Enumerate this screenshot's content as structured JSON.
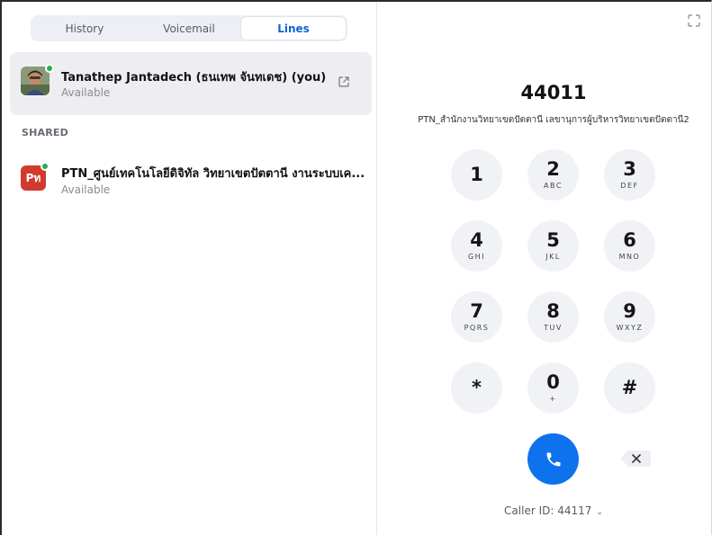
{
  "tabs": [
    {
      "label": "History"
    },
    {
      "label": "Voicemail"
    },
    {
      "label": "Lines"
    }
  ],
  "my_line": {
    "name": "Tanathep Jantadech (ธนเทพ จันทเดช) (you)",
    "status": "Available"
  },
  "shared": {
    "section_label": "SHARED",
    "line": {
      "avatar_text": "Pท",
      "name": "PTN_ศูนย์เทคโนโลยีดิจิทัล วิทยาเขตปัตตานี งานระบบเค...",
      "status": "Available"
    }
  },
  "dialer": {
    "number": "44011",
    "line_description": "PTN_สำนักงานวิทยาเขตปัตตานี เลขานุการผู้บริหารวิทยาเขตปัตตานี2",
    "keys": [
      {
        "digit": "1",
        "letters": ""
      },
      {
        "digit": "2",
        "letters": "ABC"
      },
      {
        "digit": "3",
        "letters": "DEF"
      },
      {
        "digit": "4",
        "letters": "GHI"
      },
      {
        "digit": "5",
        "letters": "JKL"
      },
      {
        "digit": "6",
        "letters": "MNO"
      },
      {
        "digit": "7",
        "letters": "PQRS"
      },
      {
        "digit": "8",
        "letters": "TUV"
      },
      {
        "digit": "9",
        "letters": "WXYZ"
      },
      {
        "digit": "*",
        "letters": ""
      },
      {
        "digit": "0",
        "letters": "+"
      },
      {
        "digit": "#",
        "letters": ""
      }
    ],
    "caller_id": "Caller ID: 44117"
  },
  "colors": {
    "accent": "#0e72ed",
    "presence": "#22b14c",
    "shared_avatar": "#d13b2e"
  }
}
